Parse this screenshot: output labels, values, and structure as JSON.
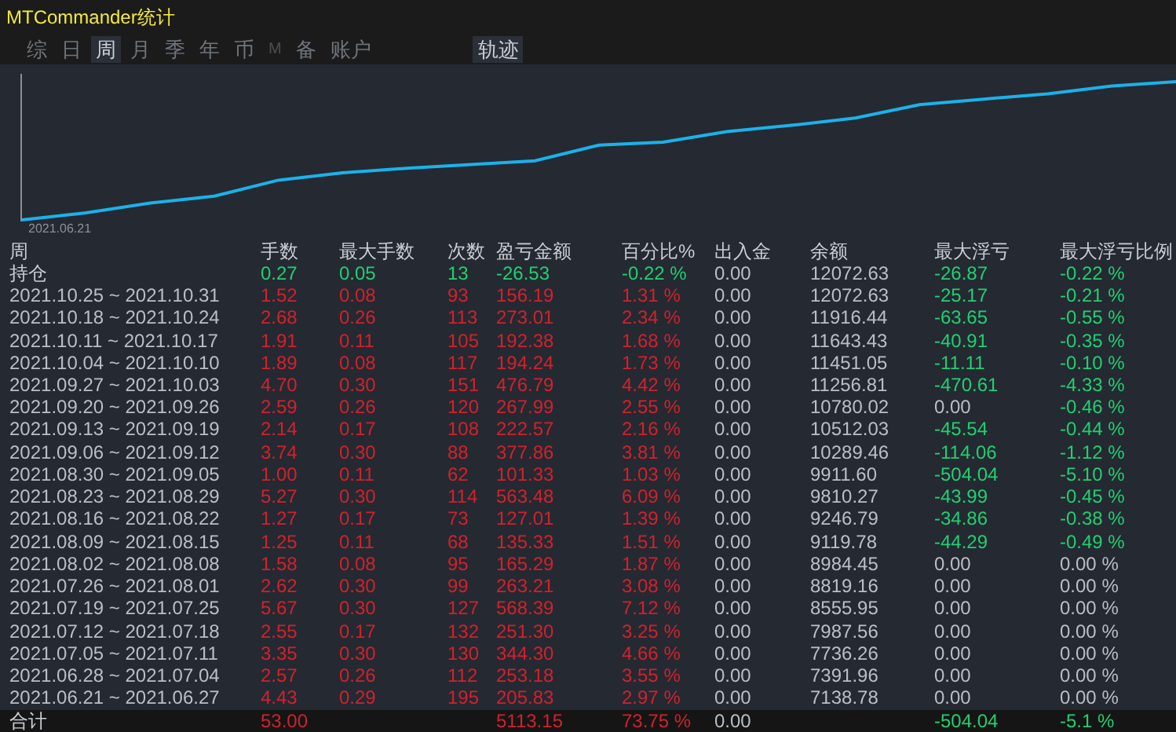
{
  "window": {
    "title": "MTCommander统计"
  },
  "tabs": [
    {
      "label": "综",
      "selected": false,
      "disabled": false
    },
    {
      "label": "日",
      "selected": false,
      "disabled": false
    },
    {
      "label": "周",
      "selected": true,
      "disabled": false
    },
    {
      "label": "月",
      "selected": false,
      "disabled": false
    },
    {
      "label": "季",
      "selected": false,
      "disabled": false
    },
    {
      "label": "年",
      "selected": false,
      "disabled": false
    },
    {
      "label": "币",
      "selected": false,
      "disabled": false
    },
    {
      "label": "M",
      "selected": false,
      "disabled": true
    },
    {
      "label": "备",
      "selected": false,
      "disabled": false
    },
    {
      "label": "账户",
      "selected": false,
      "disabled": false
    }
  ],
  "trace_button": {
    "label": "轨迹"
  },
  "chart": {
    "x_label": "2021.06.21"
  },
  "table": {
    "columns": [
      "周",
      "手数",
      "最大手数",
      "次数",
      "盈亏金额",
      "百分比%",
      "出入金",
      "余额",
      "最大浮亏",
      "最大浮亏比例"
    ],
    "rows": [
      {
        "kind": "open",
        "cells": [
          {
            "text": "持仓",
            "color": "#c8ccd3"
          },
          {
            "text": "0.27",
            "color": "#20d070"
          },
          {
            "text": "0.05",
            "color": "#20d070"
          },
          {
            "text": "13",
            "color": "#20d070"
          },
          {
            "text": "-26.53",
            "color": "#20d070"
          },
          {
            "text": "-0.22 %",
            "color": "#20d070"
          },
          {
            "text": "0.00",
            "color": "#b9bfc8"
          },
          {
            "text": "12072.63",
            "color": "#b9bfc8"
          },
          {
            "text": "-26.87",
            "color": "#20d070"
          },
          {
            "text": "-0.22 %",
            "color": "#20d070"
          }
        ]
      },
      {
        "kind": "week",
        "cells": [
          {
            "text": "2021.10.25 ~ 2021.10.31",
            "color": "#b9bfc8"
          },
          {
            "text": "1.52",
            "color": "#d1222c"
          },
          {
            "text": "0.08",
            "color": "#d1222c"
          },
          {
            "text": "93",
            "color": "#d1222c"
          },
          {
            "text": "156.19",
            "color": "#d1222c"
          },
          {
            "text": "1.31 %",
            "color": "#d1222c"
          },
          {
            "text": "0.00",
            "color": "#b9bfc8"
          },
          {
            "text": "12072.63",
            "color": "#b9bfc8"
          },
          {
            "text": "-25.17",
            "color": "#20d070"
          },
          {
            "text": "-0.21 %",
            "color": "#20d070"
          }
        ]
      },
      {
        "kind": "week",
        "cells": [
          {
            "text": "2021.10.18 ~ 2021.10.24",
            "color": "#b9bfc8"
          },
          {
            "text": "2.68",
            "color": "#d1222c"
          },
          {
            "text": "0.26",
            "color": "#d1222c"
          },
          {
            "text": "113",
            "color": "#d1222c"
          },
          {
            "text": "273.01",
            "color": "#d1222c"
          },
          {
            "text": "2.34 %",
            "color": "#d1222c"
          },
          {
            "text": "0.00",
            "color": "#b9bfc8"
          },
          {
            "text": "11916.44",
            "color": "#b9bfc8"
          },
          {
            "text": "-63.65",
            "color": "#20d070"
          },
          {
            "text": "-0.55 %",
            "color": "#20d070"
          }
        ]
      },
      {
        "kind": "week",
        "cells": [
          {
            "text": "2021.10.11 ~ 2021.10.17",
            "color": "#b9bfc8"
          },
          {
            "text": "1.91",
            "color": "#d1222c"
          },
          {
            "text": "0.11",
            "color": "#d1222c"
          },
          {
            "text": "105",
            "color": "#d1222c"
          },
          {
            "text": "192.38",
            "color": "#d1222c"
          },
          {
            "text": "1.68 %",
            "color": "#d1222c"
          },
          {
            "text": "0.00",
            "color": "#b9bfc8"
          },
          {
            "text": "11643.43",
            "color": "#b9bfc8"
          },
          {
            "text": "-40.91",
            "color": "#20d070"
          },
          {
            "text": "-0.35 %",
            "color": "#20d070"
          }
        ]
      },
      {
        "kind": "week",
        "cells": [
          {
            "text": "2021.10.04 ~ 2021.10.10",
            "color": "#b9bfc8"
          },
          {
            "text": "1.89",
            "color": "#d1222c"
          },
          {
            "text": "0.08",
            "color": "#d1222c"
          },
          {
            "text": "117",
            "color": "#d1222c"
          },
          {
            "text": "194.24",
            "color": "#d1222c"
          },
          {
            "text": "1.73 %",
            "color": "#d1222c"
          },
          {
            "text": "0.00",
            "color": "#b9bfc8"
          },
          {
            "text": "11451.05",
            "color": "#b9bfc8"
          },
          {
            "text": "-11.11",
            "color": "#20d070"
          },
          {
            "text": "-0.10 %",
            "color": "#20d070"
          }
        ]
      },
      {
        "kind": "week",
        "cells": [
          {
            "text": "2021.09.27 ~ 2021.10.03",
            "color": "#b9bfc8"
          },
          {
            "text": "4.70",
            "color": "#d1222c"
          },
          {
            "text": "0.30",
            "color": "#d1222c"
          },
          {
            "text": "151",
            "color": "#d1222c"
          },
          {
            "text": "476.79",
            "color": "#d1222c"
          },
          {
            "text": "4.42 %",
            "color": "#d1222c"
          },
          {
            "text": "0.00",
            "color": "#b9bfc8"
          },
          {
            "text": "11256.81",
            "color": "#b9bfc8"
          },
          {
            "text": "-470.61",
            "color": "#20d070"
          },
          {
            "text": "-4.33 %",
            "color": "#20d070"
          }
        ]
      },
      {
        "kind": "week",
        "cells": [
          {
            "text": "2021.09.20 ~ 2021.09.26",
            "color": "#b9bfc8"
          },
          {
            "text": "2.59",
            "color": "#d1222c"
          },
          {
            "text": "0.26",
            "color": "#d1222c"
          },
          {
            "text": "120",
            "color": "#d1222c"
          },
          {
            "text": "267.99",
            "color": "#d1222c"
          },
          {
            "text": "2.55 %",
            "color": "#d1222c"
          },
          {
            "text": "0.00",
            "color": "#b9bfc8"
          },
          {
            "text": "10780.02",
            "color": "#b9bfc8"
          },
          {
            "text": "0.00",
            "color": "#b9bfc8"
          },
          {
            "text": "-0.46 %",
            "color": "#20d070"
          }
        ]
      },
      {
        "kind": "week",
        "cells": [
          {
            "text": "2021.09.13 ~ 2021.09.19",
            "color": "#b9bfc8"
          },
          {
            "text": "2.14",
            "color": "#d1222c"
          },
          {
            "text": "0.17",
            "color": "#d1222c"
          },
          {
            "text": "108",
            "color": "#d1222c"
          },
          {
            "text": "222.57",
            "color": "#d1222c"
          },
          {
            "text": "2.16 %",
            "color": "#d1222c"
          },
          {
            "text": "0.00",
            "color": "#b9bfc8"
          },
          {
            "text": "10512.03",
            "color": "#b9bfc8"
          },
          {
            "text": "-45.54",
            "color": "#20d070"
          },
          {
            "text": "-0.44 %",
            "color": "#20d070"
          }
        ]
      },
      {
        "kind": "week",
        "cells": [
          {
            "text": "2021.09.06 ~ 2021.09.12",
            "color": "#b9bfc8"
          },
          {
            "text": "3.74",
            "color": "#d1222c"
          },
          {
            "text": "0.30",
            "color": "#d1222c"
          },
          {
            "text": "88",
            "color": "#d1222c"
          },
          {
            "text": "377.86",
            "color": "#d1222c"
          },
          {
            "text": "3.81 %",
            "color": "#d1222c"
          },
          {
            "text": "0.00",
            "color": "#b9bfc8"
          },
          {
            "text": "10289.46",
            "color": "#b9bfc8"
          },
          {
            "text": "-114.06",
            "color": "#20d070"
          },
          {
            "text": "-1.12 %",
            "color": "#20d070"
          }
        ]
      },
      {
        "kind": "week",
        "cells": [
          {
            "text": "2021.08.30 ~ 2021.09.05",
            "color": "#b9bfc8"
          },
          {
            "text": "1.00",
            "color": "#d1222c"
          },
          {
            "text": "0.11",
            "color": "#d1222c"
          },
          {
            "text": "62",
            "color": "#d1222c"
          },
          {
            "text": "101.33",
            "color": "#d1222c"
          },
          {
            "text": "1.03 %",
            "color": "#d1222c"
          },
          {
            "text": "0.00",
            "color": "#b9bfc8"
          },
          {
            "text": "9911.60",
            "color": "#b9bfc8"
          },
          {
            "text": "-504.04",
            "color": "#20d070"
          },
          {
            "text": "-5.10 %",
            "color": "#20d070"
          }
        ]
      },
      {
        "kind": "week",
        "cells": [
          {
            "text": "2021.08.23 ~ 2021.08.29",
            "color": "#b9bfc8"
          },
          {
            "text": "5.27",
            "color": "#d1222c"
          },
          {
            "text": "0.30",
            "color": "#d1222c"
          },
          {
            "text": "114",
            "color": "#d1222c"
          },
          {
            "text": "563.48",
            "color": "#d1222c"
          },
          {
            "text": "6.09 %",
            "color": "#d1222c"
          },
          {
            "text": "0.00",
            "color": "#b9bfc8"
          },
          {
            "text": "9810.27",
            "color": "#b9bfc8"
          },
          {
            "text": "-43.99",
            "color": "#20d070"
          },
          {
            "text": "-0.45 %",
            "color": "#20d070"
          }
        ]
      },
      {
        "kind": "week",
        "cells": [
          {
            "text": "2021.08.16 ~ 2021.08.22",
            "color": "#b9bfc8"
          },
          {
            "text": "1.27",
            "color": "#d1222c"
          },
          {
            "text": "0.17",
            "color": "#d1222c"
          },
          {
            "text": "73",
            "color": "#d1222c"
          },
          {
            "text": "127.01",
            "color": "#d1222c"
          },
          {
            "text": "1.39 %",
            "color": "#d1222c"
          },
          {
            "text": "0.00",
            "color": "#b9bfc8"
          },
          {
            "text": "9246.79",
            "color": "#b9bfc8"
          },
          {
            "text": "-34.86",
            "color": "#20d070"
          },
          {
            "text": "-0.38 %",
            "color": "#20d070"
          }
        ]
      },
      {
        "kind": "week",
        "cells": [
          {
            "text": "2021.08.09 ~ 2021.08.15",
            "color": "#b9bfc8"
          },
          {
            "text": "1.25",
            "color": "#d1222c"
          },
          {
            "text": "0.11",
            "color": "#d1222c"
          },
          {
            "text": "68",
            "color": "#d1222c"
          },
          {
            "text": "135.33",
            "color": "#d1222c"
          },
          {
            "text": "1.51 %",
            "color": "#d1222c"
          },
          {
            "text": "0.00",
            "color": "#b9bfc8"
          },
          {
            "text": "9119.78",
            "color": "#b9bfc8"
          },
          {
            "text": "-44.29",
            "color": "#20d070"
          },
          {
            "text": "-0.49 %",
            "color": "#20d070"
          }
        ]
      },
      {
        "kind": "week",
        "cells": [
          {
            "text": "2021.08.02 ~ 2021.08.08",
            "color": "#b9bfc8"
          },
          {
            "text": "1.58",
            "color": "#d1222c"
          },
          {
            "text": "0.08",
            "color": "#d1222c"
          },
          {
            "text": "95",
            "color": "#d1222c"
          },
          {
            "text": "165.29",
            "color": "#d1222c"
          },
          {
            "text": "1.87 %",
            "color": "#d1222c"
          },
          {
            "text": "0.00",
            "color": "#b9bfc8"
          },
          {
            "text": "8984.45",
            "color": "#b9bfc8"
          },
          {
            "text": "0.00",
            "color": "#b9bfc8"
          },
          {
            "text": "0.00 %",
            "color": "#b9bfc8"
          }
        ]
      },
      {
        "kind": "week",
        "cells": [
          {
            "text": "2021.07.26 ~ 2021.08.01",
            "color": "#b9bfc8"
          },
          {
            "text": "2.62",
            "color": "#d1222c"
          },
          {
            "text": "0.30",
            "color": "#d1222c"
          },
          {
            "text": "99",
            "color": "#d1222c"
          },
          {
            "text": "263.21",
            "color": "#d1222c"
          },
          {
            "text": "3.08 %",
            "color": "#d1222c"
          },
          {
            "text": "0.00",
            "color": "#b9bfc8"
          },
          {
            "text": "8819.16",
            "color": "#b9bfc8"
          },
          {
            "text": "0.00",
            "color": "#b9bfc8"
          },
          {
            "text": "0.00 %",
            "color": "#b9bfc8"
          }
        ]
      },
      {
        "kind": "week",
        "cells": [
          {
            "text": "2021.07.19 ~ 2021.07.25",
            "color": "#b9bfc8"
          },
          {
            "text": "5.67",
            "color": "#d1222c"
          },
          {
            "text": "0.30",
            "color": "#d1222c"
          },
          {
            "text": "127",
            "color": "#d1222c"
          },
          {
            "text": "568.39",
            "color": "#d1222c"
          },
          {
            "text": "7.12 %",
            "color": "#d1222c"
          },
          {
            "text": "0.00",
            "color": "#b9bfc8"
          },
          {
            "text": "8555.95",
            "color": "#b9bfc8"
          },
          {
            "text": "0.00",
            "color": "#b9bfc8"
          },
          {
            "text": "0.00 %",
            "color": "#b9bfc8"
          }
        ]
      },
      {
        "kind": "week",
        "cells": [
          {
            "text": "2021.07.12 ~ 2021.07.18",
            "color": "#b9bfc8"
          },
          {
            "text": "2.55",
            "color": "#d1222c"
          },
          {
            "text": "0.17",
            "color": "#d1222c"
          },
          {
            "text": "132",
            "color": "#d1222c"
          },
          {
            "text": "251.30",
            "color": "#d1222c"
          },
          {
            "text": "3.25 %",
            "color": "#d1222c"
          },
          {
            "text": "0.00",
            "color": "#b9bfc8"
          },
          {
            "text": "7987.56",
            "color": "#b9bfc8"
          },
          {
            "text": "0.00",
            "color": "#b9bfc8"
          },
          {
            "text": "0.00 %",
            "color": "#b9bfc8"
          }
        ]
      },
      {
        "kind": "week",
        "cells": [
          {
            "text": "2021.07.05 ~ 2021.07.11",
            "color": "#b9bfc8"
          },
          {
            "text": "3.35",
            "color": "#d1222c"
          },
          {
            "text": "0.30",
            "color": "#d1222c"
          },
          {
            "text": "130",
            "color": "#d1222c"
          },
          {
            "text": "344.30",
            "color": "#d1222c"
          },
          {
            "text": "4.66 %",
            "color": "#d1222c"
          },
          {
            "text": "0.00",
            "color": "#b9bfc8"
          },
          {
            "text": "7736.26",
            "color": "#b9bfc8"
          },
          {
            "text": "0.00",
            "color": "#b9bfc8"
          },
          {
            "text": "0.00 %",
            "color": "#b9bfc8"
          }
        ]
      },
      {
        "kind": "week",
        "cells": [
          {
            "text": "2021.06.28 ~ 2021.07.04",
            "color": "#b9bfc8"
          },
          {
            "text": "2.57",
            "color": "#d1222c"
          },
          {
            "text": "0.26",
            "color": "#d1222c"
          },
          {
            "text": "112",
            "color": "#d1222c"
          },
          {
            "text": "253.18",
            "color": "#d1222c"
          },
          {
            "text": "3.55 %",
            "color": "#d1222c"
          },
          {
            "text": "0.00",
            "color": "#b9bfc8"
          },
          {
            "text": "7391.96",
            "color": "#b9bfc8"
          },
          {
            "text": "0.00",
            "color": "#b9bfc8"
          },
          {
            "text": "0.00 %",
            "color": "#b9bfc8"
          }
        ]
      },
      {
        "kind": "week",
        "cells": [
          {
            "text": "2021.06.21 ~ 2021.06.27",
            "color": "#b9bfc8"
          },
          {
            "text": "4.43",
            "color": "#d1222c"
          },
          {
            "text": "0.29",
            "color": "#d1222c"
          },
          {
            "text": "195",
            "color": "#d1222c"
          },
          {
            "text": "205.83",
            "color": "#d1222c"
          },
          {
            "text": "2.97 %",
            "color": "#d1222c"
          },
          {
            "text": "0.00",
            "color": "#b9bfc8"
          },
          {
            "text": "7138.78",
            "color": "#b9bfc8"
          },
          {
            "text": "0.00",
            "color": "#b9bfc8"
          },
          {
            "text": "0.00 %",
            "color": "#b9bfc8"
          }
        ]
      },
      {
        "kind": "total",
        "cells": [
          {
            "text": "合计",
            "color": "#c8ccd3"
          },
          {
            "text": "53.00",
            "color": "#d1222c"
          },
          null,
          null,
          {
            "text": "5113.15",
            "color": "#d1222c"
          },
          {
            "text": "73.75 %",
            "color": "#d1222c"
          },
          {
            "text": "0.00",
            "color": "#b9bfc8"
          },
          null,
          {
            "text": "-504.04",
            "color": "#20d070"
          },
          {
            "text": "-5.1 %",
            "color": "#20d070"
          }
        ]
      }
    ]
  }
}
